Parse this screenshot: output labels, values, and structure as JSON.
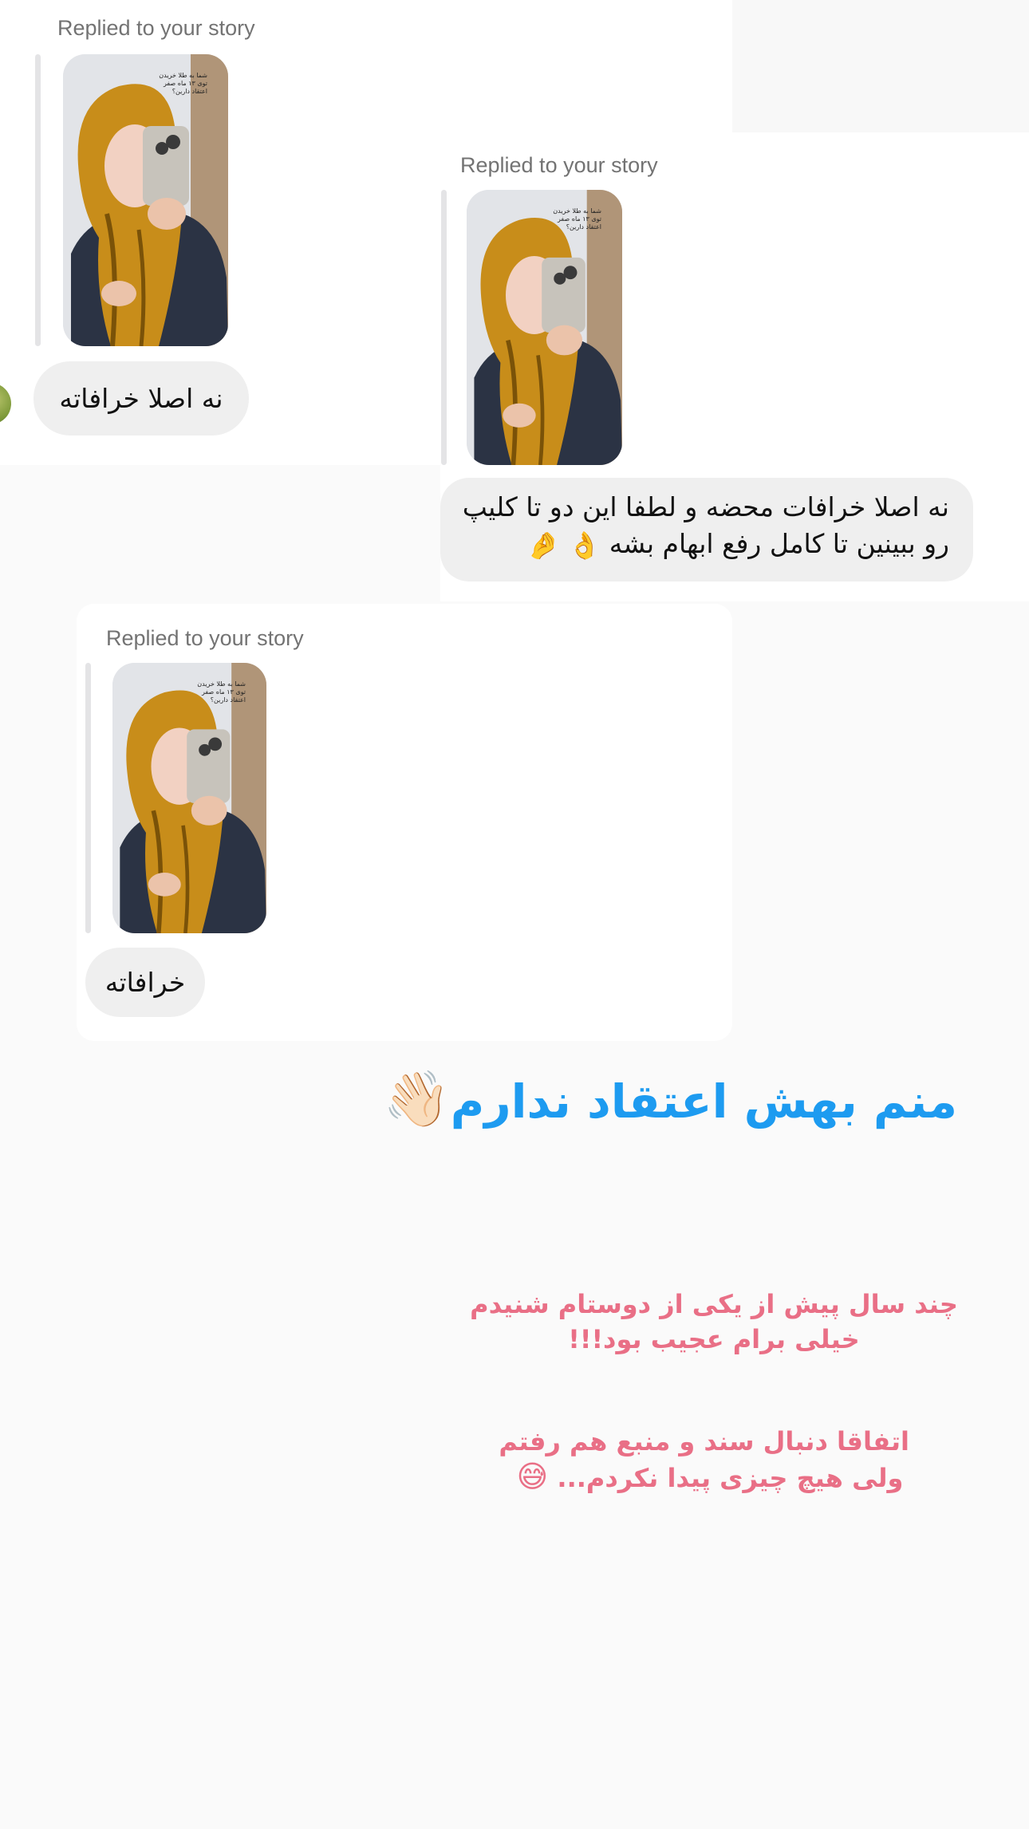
{
  "messages": [
    {
      "replied_label": "Replied to your story",
      "text": "نه اصلا خرافاته"
    },
    {
      "replied_label": "Replied to your story",
      "line1": "نه اصلا خرافات محضه و لطفا این دو تا کلیپ",
      "line2": "رو ببینین تا کامل رفع ابهام بشه",
      "emojis": "👌 🤌"
    },
    {
      "replied_label": "Replied to your story",
      "text": "خرافاته"
    }
  ],
  "story_overlay_text": [
    "شما به طلا خریدن",
    "توی ۱۳ ماه صفر",
    "اعتقاد دارین؟"
  ],
  "caption": {
    "headline": "منم بهش اعتقاد ندارم",
    "headline_emoji": "👋🏻",
    "paragraph1": [
      "چند سال پیش از یکی از دوستام شنیدم",
      "خیلی برام عجیب بود!!!"
    ],
    "paragraph2": [
      "اتفاقا  دنبال سند و منبع هم رفتم",
      "ولی هیچ چیزی پیدا نکردم..."
    ],
    "paragraph2_emoji": "😅"
  },
  "colors": {
    "headline": "#1d9bf0",
    "pink_text": "#e96f86",
    "bubble": "#efefef",
    "background": "#fafafa"
  }
}
